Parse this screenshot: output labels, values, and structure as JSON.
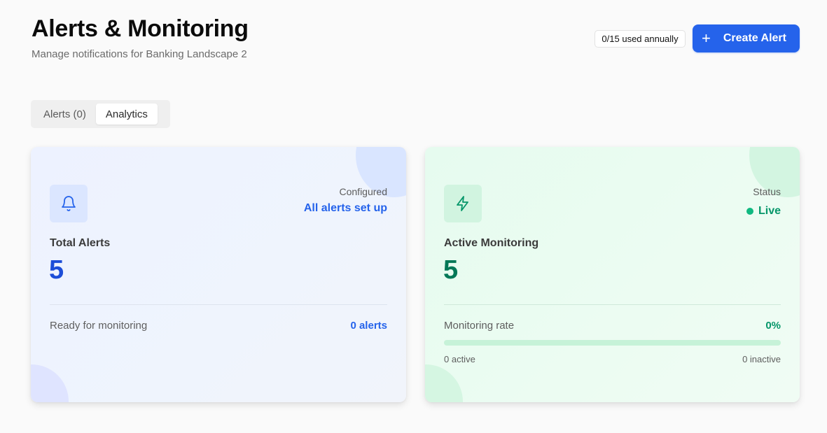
{
  "header": {
    "title": "Alerts & Monitoring",
    "subtitle": "Manage notifications for Banking Landscape 2",
    "usage_badge": "0/15 used annually",
    "create_button": {
      "icon": "plus-icon",
      "label": "Create Alert"
    }
  },
  "tabs": [
    {
      "label": "Alerts (0)",
      "active": false
    },
    {
      "label": "Analytics",
      "active": true
    }
  ],
  "cards": {
    "total_alerts": {
      "icon": "bell-icon",
      "corner_label": "Configured",
      "corner_value": "All alerts set up",
      "metric_label": "Total Alerts",
      "metric_value": "5",
      "footer_label": "Ready for monitoring",
      "footer_value": "0 alerts",
      "accent_color": "#2563eb"
    },
    "active_monitoring": {
      "icon": "lightning-icon",
      "corner_label": "Status",
      "corner_value": "Live",
      "metric_label": "Active Monitoring",
      "metric_value": "5",
      "footer_label": "Monitoring rate",
      "footer_value": "0%",
      "progress_fraction": 0,
      "active_text": "0 active",
      "inactive_text": "0 inactive",
      "accent_color": "#059669"
    }
  },
  "colors": {
    "primary": "#2563eb",
    "success": "#10b981",
    "background": "#fafafa"
  }
}
